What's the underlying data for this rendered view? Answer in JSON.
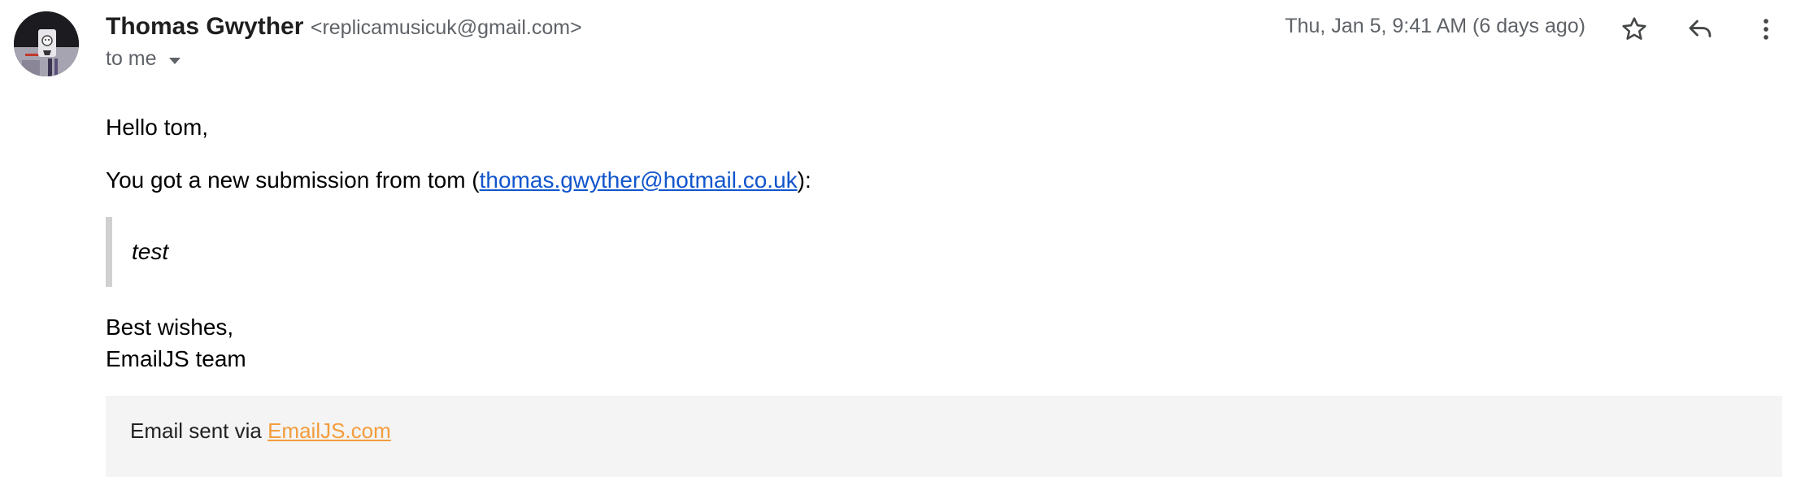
{
  "sender": {
    "name": "Thomas Gwyther",
    "email": "<replicamusicuk@gmail.com>",
    "recipient": "to me"
  },
  "header": {
    "date": "Thu, Jan 5, 9:41 AM (6 days ago)",
    "icons": [
      "star-icon",
      "reply-icon",
      "more-vert-icon",
      "chevron-down-icon"
    ]
  },
  "message": {
    "greeting": "Hello tom,",
    "submission_prefix": "You got a new submission from tom (",
    "submission_link": "thomas.gwyther@hotmail.co.uk",
    "submission_suffix": "):",
    "quote": "test",
    "signoff_line1": "Best wishes,",
    "signoff_line2": "EmailJS team"
  },
  "footer": {
    "prefix": "Email sent via ",
    "link": "EmailJS.com"
  },
  "colors": {
    "link": "#1155cc",
    "footer_link": "#f39c3d",
    "footer_bg": "#f4f4f4",
    "quote_bar": "#d0d0d0"
  }
}
